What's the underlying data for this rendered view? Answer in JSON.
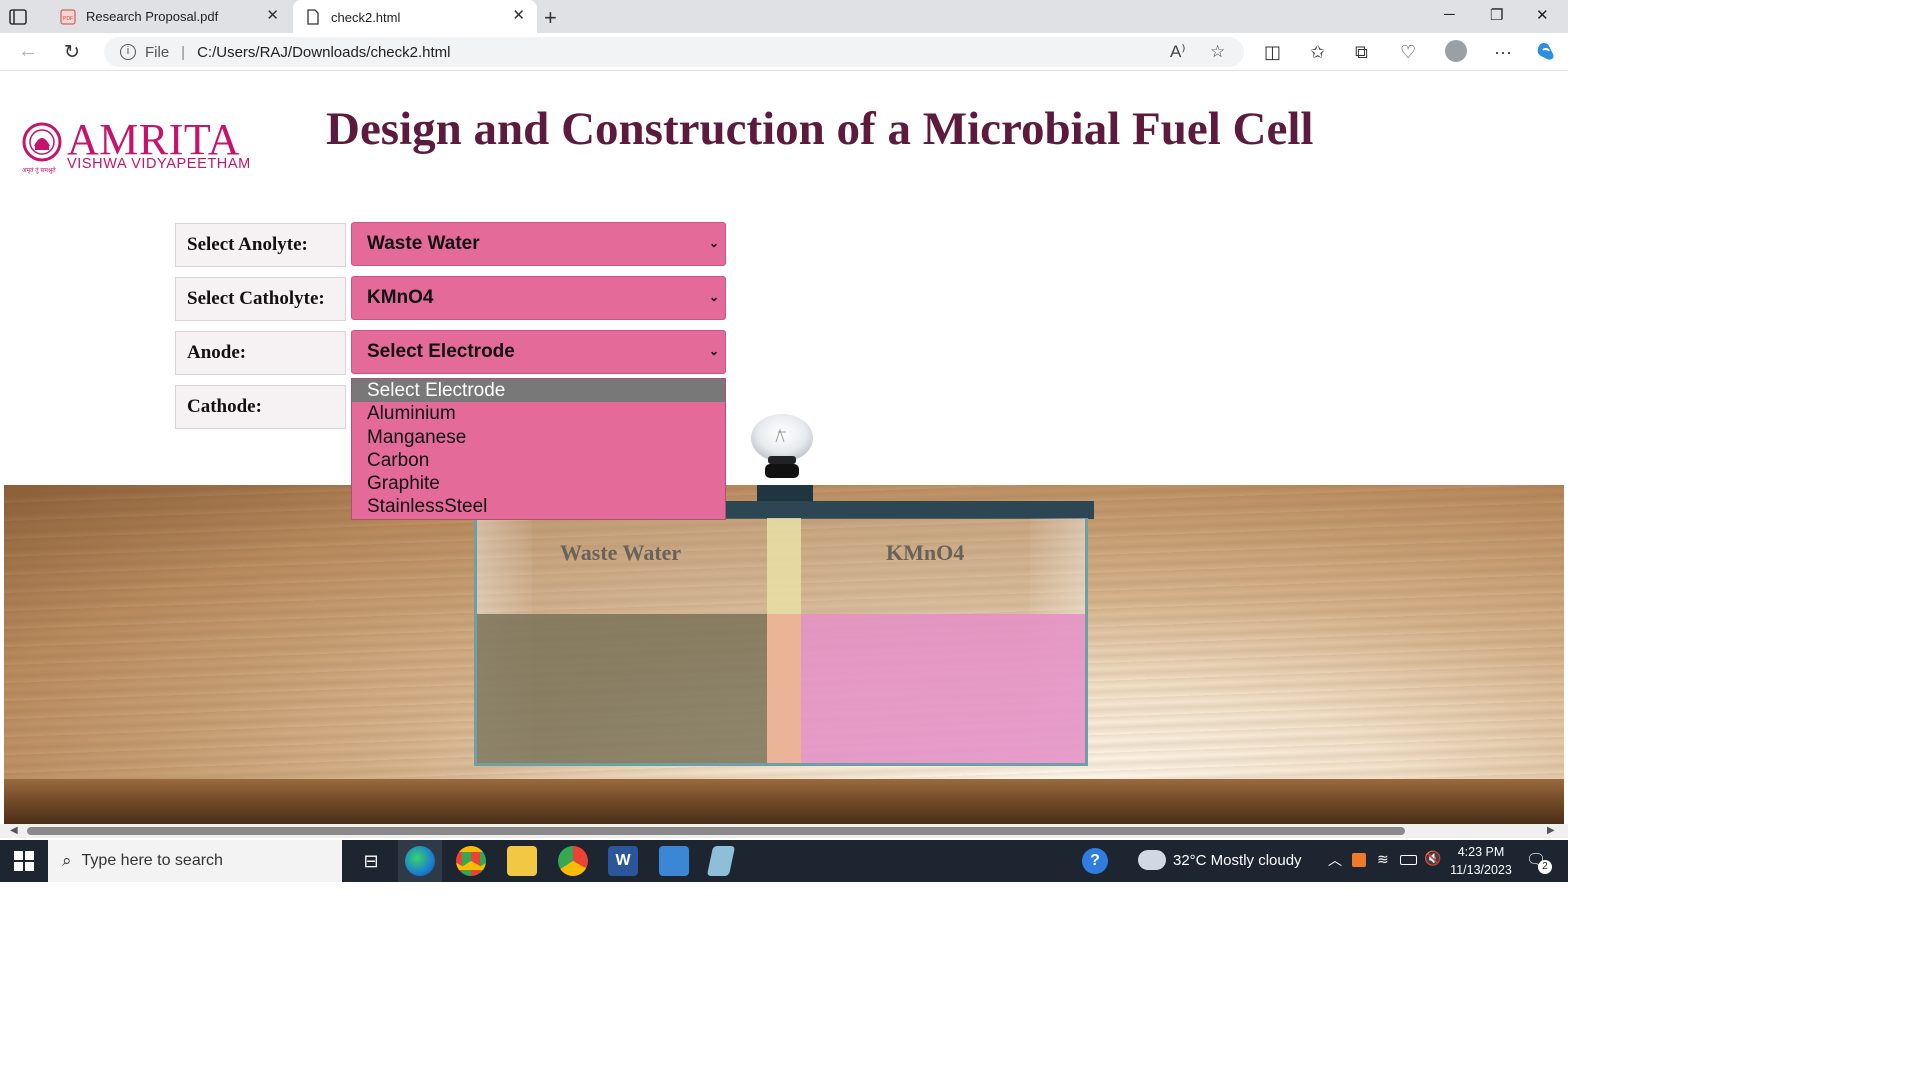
{
  "browser": {
    "tabs": [
      {
        "title": "Research Proposal.pdf",
        "active": false
      },
      {
        "title": "check2.html",
        "active": true
      }
    ],
    "address": {
      "scheme_label": "File",
      "url": "C:/Users/RAJ/Downloads/check2.html"
    }
  },
  "page": {
    "logo": {
      "name": "AMRITA",
      "subtitle": "VISHWA VIDYAPEETHAM",
      "tagline": "अमृतं तुं समश्नुते"
    },
    "title": "Design and Construction of a Microbial Fuel Cell",
    "controls": [
      {
        "label": "Select Anolyte:",
        "value": "Waste Water"
      },
      {
        "label": "Select Catholyte:",
        "value": "KMnO4"
      },
      {
        "label": "Anode:",
        "value": "Select Electrode"
      },
      {
        "label": "Cathode:",
        "value": ""
      }
    ],
    "anode_dropdown": {
      "options": [
        "Select Electrode",
        "Aluminium",
        "Manganese",
        "Carbon",
        "Graphite",
        "StainlessSteel"
      ],
      "highlighted": "Select Electrode"
    },
    "tank": {
      "left_label": "Waste Water",
      "right_label": "KMnO4"
    }
  },
  "taskbar": {
    "search_placeholder": "Type here to search",
    "weather": "32°C  Mostly cloudy",
    "time": "4:23 PM",
    "date": "11/13/2023",
    "notification_count": "2"
  },
  "colors": {
    "title": "#5c1a3c",
    "brand": "#c5146b",
    "select_bg": "#e36a99",
    "anolyte_liquid": "#786f55",
    "catholyte_liquid": "#e48ec5"
  }
}
